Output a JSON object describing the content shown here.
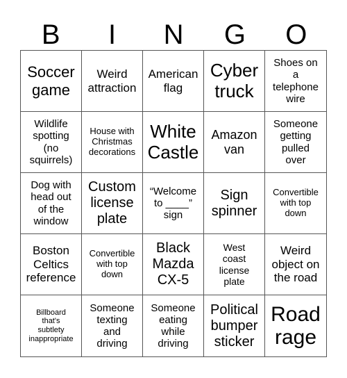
{
  "header": [
    "B",
    "I",
    "N",
    "G",
    "O"
  ],
  "cells": [
    "Soccer\ngame",
    "Weird\nattraction",
    "American\nflag",
    "Cyber\ntruck",
    "Shoes on\na\ntelephone\nwire",
    "Wildlife\nspotting\n(no\nsquirrels)",
    "House with\nChristmas\ndecorations",
    "White\nCastle",
    "Amazon\nvan",
    "Someone\ngetting\npulled\nover",
    "Dog with\nhead out\nof the\nwindow",
    "Custom\nlicense\nplate",
    "“Welcome\nto ____”\nsign",
    "Sign\nspinner",
    "Convertible\nwith top\ndown",
    "Boston\nCeltics\nreference",
    "Convertible\nwith top\ndown",
    "Black\nMazda\nCX-5",
    "West\ncoast\nlicense\nplate",
    "Weird\nobject on\nthe road",
    "Billboard\nthat's\nsubtlety\ninappropriate",
    "Someone\ntexting\nand\ndriving",
    "Someone\neating\nwhile\ndriving",
    "Political\nbumper\nsticker",
    "Road\nrage"
  ]
}
